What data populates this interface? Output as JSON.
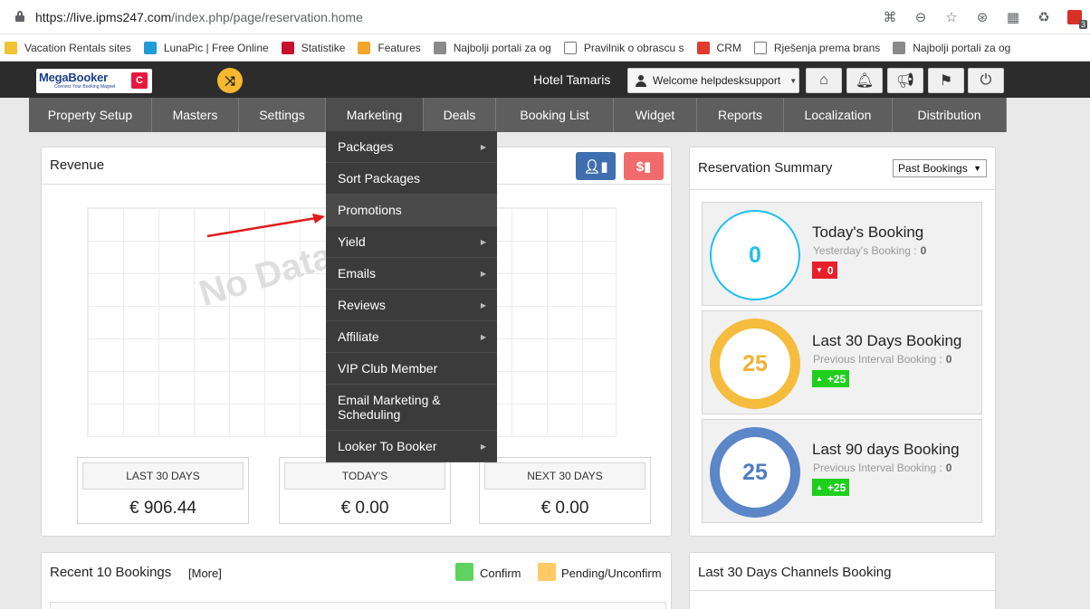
{
  "browser": {
    "url_main": "https://live.ipms247.com",
    "url_path": "/index.php/page/reservation.home",
    "ext_badge": "3",
    "bookmarks": [
      {
        "label": "Vacation Rentals sites",
        "color": "#f2c232"
      },
      {
        "label": "LunaPic | Free Online",
        "color": "#1f9bd7"
      },
      {
        "label": "Statistike",
        "color": "#c8102e"
      },
      {
        "label": "Features",
        "color": "#f4a62a"
      },
      {
        "label": "Najbolji portali za og",
        "color": "#8a8a8a"
      },
      {
        "label": "Pravilnik o obrascu s",
        "color": "#ffffff"
      },
      {
        "label": "CRM",
        "color": "#e03a2f"
      },
      {
        "label": "Rješenja prema brans",
        "color": "#ffffff"
      },
      {
        "label": "Najbolji portali za og",
        "color": "#8a8a8a"
      }
    ]
  },
  "header": {
    "logo_text": "MegaBooker",
    "logo_sub": "Connect Your Booking Magnet",
    "hotel_name": "Hotel Tamaris",
    "welcome": "Welcome helpdesksupport"
  },
  "nav": {
    "items": [
      {
        "label": "Property Setup",
        "w": 136
      },
      {
        "label": "Masters",
        "w": 96
      },
      {
        "label": "Settings",
        "w": 96
      },
      {
        "label": "Marketing",
        "w": 108
      },
      {
        "label": "Deals",
        "w": 80
      },
      {
        "label": "Booking List",
        "w": 130
      },
      {
        "label": "Widget",
        "w": 92
      },
      {
        "label": "Reports",
        "w": 96
      },
      {
        "label": "Localization",
        "w": 120
      },
      {
        "label": "Distribution",
        "w": 126
      }
    ]
  },
  "marketing_menu": {
    "items": [
      {
        "label": "Packages",
        "submenu": true
      },
      {
        "label": "Sort Packages",
        "submenu": false
      },
      {
        "label": "Promotions",
        "submenu": false,
        "hover": true
      },
      {
        "label": "Yield",
        "submenu": true
      },
      {
        "label": "Emails",
        "submenu": true
      },
      {
        "label": "Reviews",
        "submenu": true
      },
      {
        "label": "Affiliate",
        "submenu": true
      },
      {
        "label": "VIP Club Member",
        "submenu": false
      },
      {
        "label": "Email Marketing & Scheduling",
        "submenu": false
      },
      {
        "label": "Looker To Booker",
        "submenu": true
      }
    ]
  },
  "revenue": {
    "title": "Revenue",
    "no_data": "No Data Available",
    "stats": [
      {
        "label": "LAST 30 DAYS",
        "value": "€ 906.44"
      },
      {
        "label": "TODAY'S",
        "value": "€ 0.00"
      },
      {
        "label": "NEXT 30 DAYS",
        "value": "€ 0.00"
      }
    ]
  },
  "summary": {
    "title": "Reservation Summary",
    "filter": "Past Bookings",
    "cards": [
      {
        "title": "Today's Booking",
        "sub_label": "Yesterday's Booking :",
        "sub_value": "0",
        "count": "0",
        "badge": "0",
        "badge_dir": "down",
        "ring": "#1ec0ee",
        "ring_width": 2,
        "num_color": "#1ec0ee"
      },
      {
        "title": "Last 30 Days Booking",
        "sub_label": "Previous Interval Booking :",
        "sub_value": "0",
        "count": "25",
        "badge": "+25",
        "badge_dir": "up",
        "ring": "#f5bc3d",
        "ring_width": 11,
        "num_color": "#f0b232"
      },
      {
        "title": "Last 90 days Booking",
        "sub_label": "Previous Interval Booking :",
        "sub_value": "0",
        "count": "25",
        "badge": "+25",
        "badge_dir": "up",
        "ring": "#5b86c8",
        "ring_width": 11,
        "num_color": "#4f7bc0"
      }
    ]
  },
  "recent": {
    "title": "Recent 10 Bookings",
    "more": "[More]",
    "legend": [
      {
        "label": "Confirm",
        "color": "#5fd35f"
      },
      {
        "label": "Pending/Unconfirm",
        "color": "#ffca66"
      }
    ]
  },
  "channels": {
    "title": "Last 30 Days Channels Booking"
  },
  "colors": {
    "header_bg": "#2c2c2c",
    "nav_bg": "#5e5e5e",
    "menu_bg": "#3b3b3b",
    "badge_up": "#1ecf1e",
    "badge_down": "#e8202a"
  }
}
